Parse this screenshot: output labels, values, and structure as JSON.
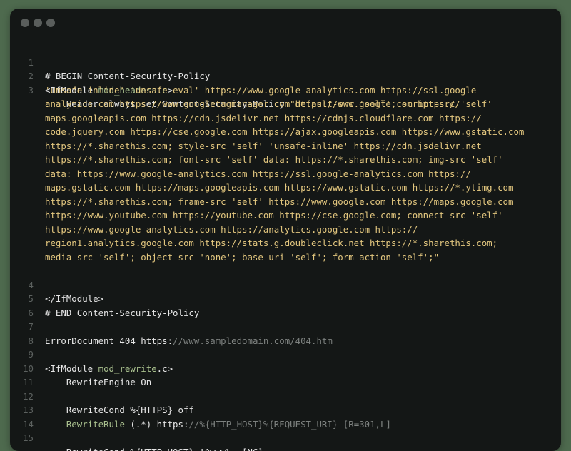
{
  "window": {
    "controls": [
      "close",
      "minimize",
      "maximize"
    ]
  },
  "colors": {
    "background": "#4e6a4e",
    "editor_bg": "#141716",
    "line_number": "#5c615f",
    "text": "#e6e6e6",
    "module_name": "#a9c08e",
    "string": "#e3c77f",
    "muted_url": "#7d817f"
  },
  "code": {
    "l1": "# BEGIN Content-Security-Policy",
    "l2_kw": "<IfModule ",
    "l2_mod": "mod_headers.c",
    "l2_end": ">",
    "l3_kw": "    Header always set Content-Security-Policy ",
    "l3_s1": "\"default-src 'self'; script-src 'self'",
    "w1": "'unsafe-inline' 'unsafe-eval' https://www.google-analytics.com https://ssl.google-",
    "w2": "analytics.com https://www.googletagmanager.com https://www.google.com https://",
    "w3": "maps.googleapis.com https://cdn.jsdelivr.net https://cdnjs.cloudflare.com https://",
    "w4": "code.jquery.com https://cse.google.com https://ajax.googleapis.com https://www.gstatic.com",
    "w5": "https://*.sharethis.com; style-src 'self' 'unsafe-inline' https://cdn.jsdelivr.net",
    "w6": "https://*.sharethis.com; font-src 'self' data: https://*.sharethis.com; img-src 'self'",
    "w7": "data: https://www.google-analytics.com https://ssl.google-analytics.com https://",
    "w8": "maps.gstatic.com https://maps.googleapis.com https://www.gstatic.com https://*.ytimg.com",
    "w9": "https://*.sharethis.com; frame-src 'self' https://www.google.com https://maps.google.com",
    "w10": "https://www.youtube.com https://youtube.com https://cse.google.com; connect-src 'self'",
    "w11": "https://www.google-analytics.com https://analytics.google.com https://",
    "w12": "region1.analytics.google.com https://stats.g.doubleclick.net https://*.sharethis.com;",
    "w13": "media-src 'self'; object-src 'none'; base-uri 'self'; form-action 'self';\"",
    "l4": "</IfModule>",
    "l5": "# END Content-Security-Policy",
    "l7_kw": "ErrorDocument 404 https:",
    "l7_url": "//www.sampledomain.com/404.htm",
    "l9_kw": "<IfModule ",
    "l9_mod": "mod_rewrite",
    "l9_end": ".c>",
    "l10": "    RewriteEngine On",
    "l12": "    RewriteCond %{HTTPS} off",
    "l13_pre": "    ",
    "l13_rule": "RewriteRule",
    "l13_kw": " (.*) https:",
    "l13_rest": "//%{HTTP_HOST}%{REQUEST_URI} [R=301,L]",
    "l15": "    RewriteCond %{HTTP_HOST} !^www\\. [NC]"
  },
  "line_numbers": {
    "n1": "1",
    "n2": "2",
    "n3": "3",
    "n4": "4",
    "n5": "5",
    "n6": "6",
    "n7": "7",
    "n8": "8",
    "n9": "9",
    "n10": "10",
    "n11": "11",
    "n12": "12",
    "n13": "13",
    "n14": "14",
    "n15": "15"
  }
}
